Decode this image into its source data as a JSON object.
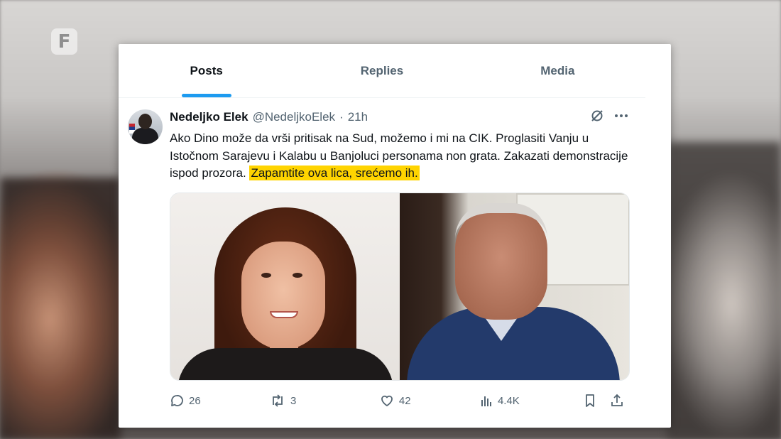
{
  "channel": {
    "logo_letter": "F"
  },
  "tabs": [
    {
      "label": "Posts",
      "active": true
    },
    {
      "label": "Replies",
      "active": false
    },
    {
      "label": "Media",
      "active": false
    }
  ],
  "tweet": {
    "name": "Nedeljko Elek",
    "handle": "@NedeljkoElek",
    "separator": "·",
    "time": "21h",
    "text_main": "Ako Dino može da vrši pritisak na Sud, možemo i mi na CIK. Proglasiti Vanju u Istočnom Sarajevu i Kalabu u Banjolucі personama non grata. Zakazati demonstracije ispod prozora. ",
    "text_highlight": "Zapamtite ova lica, srećemo ih.",
    "highlight_color": "#ffd400"
  },
  "actions": {
    "replies": "26",
    "reposts": "3",
    "likes": "42",
    "views": "4.4K"
  },
  "colors": {
    "accent": "#1d9bf0",
    "text_primary": "#0f1419",
    "text_secondary": "#536471"
  }
}
